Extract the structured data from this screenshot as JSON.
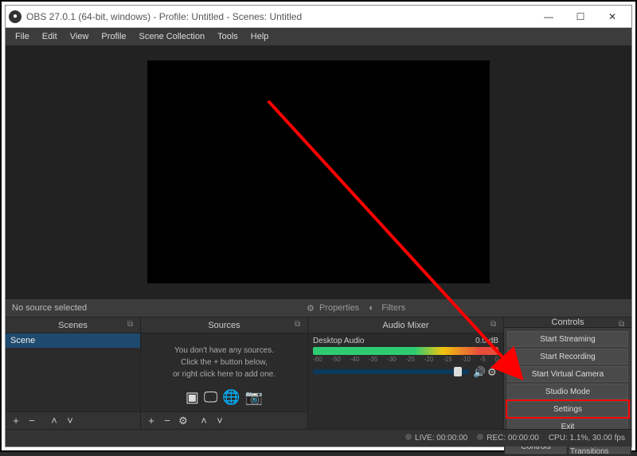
{
  "titlebar": {
    "title": "OBS 27.0.1 (64-bit, windows) - Profile: Untitled - Scenes: Untitled"
  },
  "menu": {
    "file": "File",
    "edit": "Edit",
    "view": "View",
    "profile": "Profile",
    "scene_collection": "Scene Collection",
    "tools": "Tools",
    "help": "Help"
  },
  "infobar": {
    "no_source": "No source selected",
    "properties": "Properties",
    "filters": "Filters"
  },
  "panels": {
    "scenes_title": "Scenes",
    "sources_title": "Sources",
    "mixer_title": "Audio Mixer",
    "controls_title": "Controls"
  },
  "scenes": {
    "item1": "Scene"
  },
  "sources": {
    "empty_line1": "You don't have any sources.",
    "empty_line2": "Click the + button below,",
    "empty_line3": "or right click here to add one."
  },
  "mixer": {
    "track_name": "Desktop Audio",
    "track_db": "0.0 dB",
    "ticks": {
      "a": "-60",
      "b": "-50",
      "c": "-40",
      "d": "-35",
      "e": "-30",
      "f": "-25",
      "g": "-20",
      "h": "-15",
      "i": "-10",
      "j": "-5",
      "k": "0"
    }
  },
  "controls": {
    "start_streaming": "Start Streaming",
    "start_recording": "Start Recording",
    "start_virtual_camera": "Start Virtual Camera",
    "studio_mode": "Studio Mode",
    "settings": "Settings",
    "exit": "Exit",
    "tab_controls": "Controls",
    "tab_transitions": "Scene Transitions"
  },
  "status": {
    "live": "LIVE: 00:00:00",
    "rec": "REC: 00:00:00",
    "cpu": "CPU: 1.1%, 30.00 fps"
  }
}
